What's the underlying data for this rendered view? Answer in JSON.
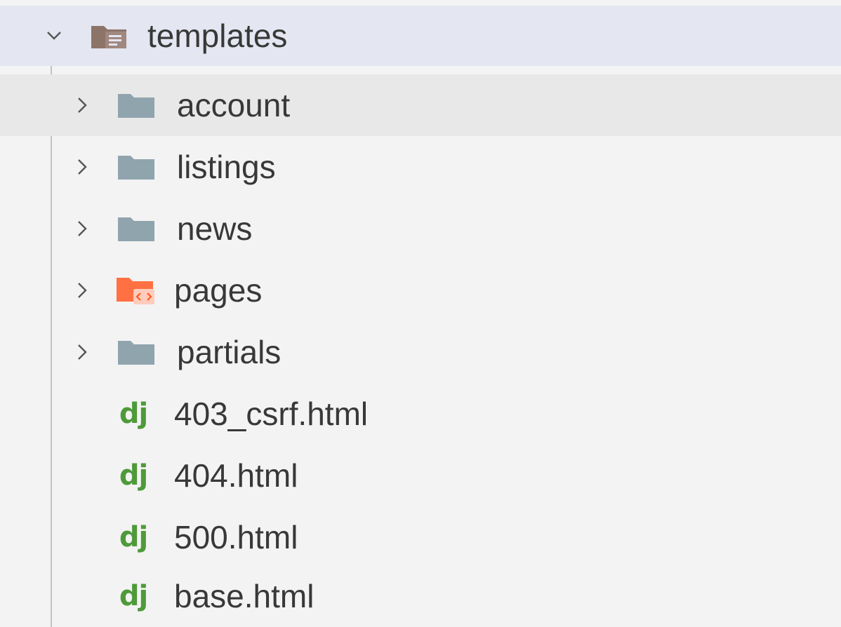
{
  "explorer": {
    "parent": {
      "label": "templates",
      "expanded": true,
      "icon": "folder-templates-open-icon"
    },
    "children": [
      {
        "label": "account",
        "type": "folder",
        "icon": "folder-icon"
      },
      {
        "label": "listings",
        "type": "folder",
        "icon": "folder-icon"
      },
      {
        "label": "news",
        "type": "folder",
        "icon": "folder-icon"
      },
      {
        "label": "pages",
        "type": "folder",
        "icon": "folder-html-icon"
      },
      {
        "label": "partials",
        "type": "folder",
        "icon": "folder-icon"
      },
      {
        "label": "403_csrf.html",
        "type": "file",
        "icon_text": "dj"
      },
      {
        "label": "404.html",
        "type": "file",
        "icon_text": "dj"
      },
      {
        "label": "500.html",
        "type": "file",
        "icon_text": "dj"
      },
      {
        "label": "base.html",
        "type": "file",
        "icon_text": "dj"
      }
    ],
    "colors": {
      "parent_row_bg": "#e4e6f1",
      "hover_row_bg": "#e8e8e8",
      "folder_gray": "#90a4ae",
      "folder_html_orange": "#ff7043",
      "django_green": "#4e9a3a"
    }
  }
}
